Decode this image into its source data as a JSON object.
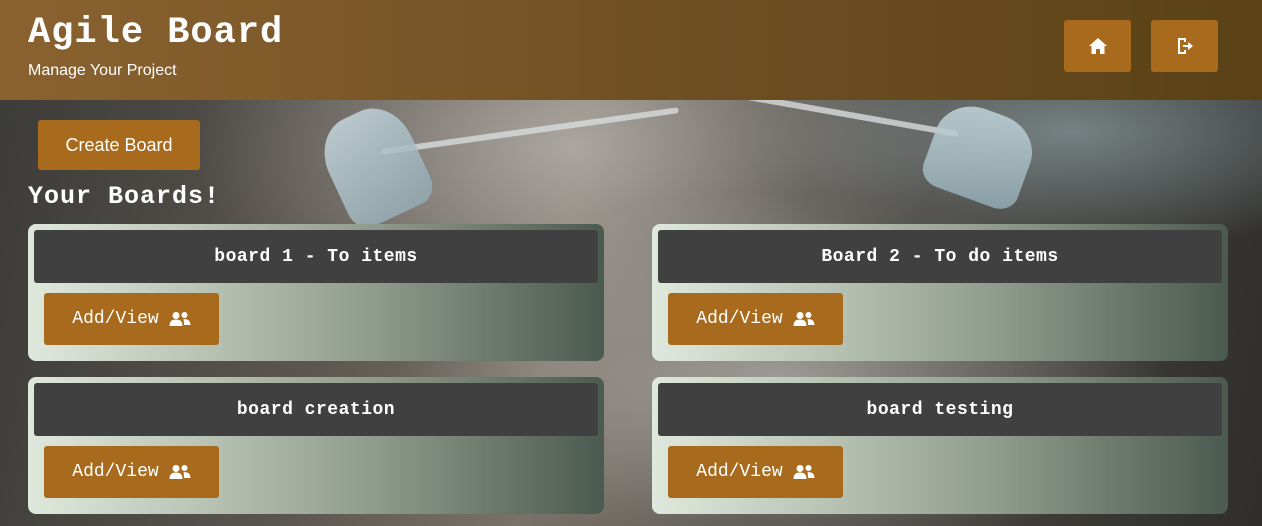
{
  "header": {
    "title": "Agile Board",
    "subtitle": "Manage Your Project",
    "home_icon": "home-icon",
    "logout_icon": "sign-out-icon"
  },
  "main": {
    "create_board_label": "Create Board",
    "section_title": "Your Boards!",
    "boards": [
      {
        "name": "board 1 - To items",
        "action_label": "Add/View",
        "action_icon": "users-icon"
      },
      {
        "name": "Board 2 - To do items",
        "action_label": "Add/View",
        "action_icon": "users-icon"
      },
      {
        "name": "board creation",
        "action_label": "Add/View",
        "action_icon": "users-icon"
      },
      {
        "name": "board testing",
        "action_label": "Add/View",
        "action_icon": "users-icon"
      }
    ]
  },
  "colors": {
    "header_start": "#8a6230",
    "header_end": "#5a4216",
    "accent_button": "#a86b1e",
    "board_title_bg": "#404040"
  }
}
